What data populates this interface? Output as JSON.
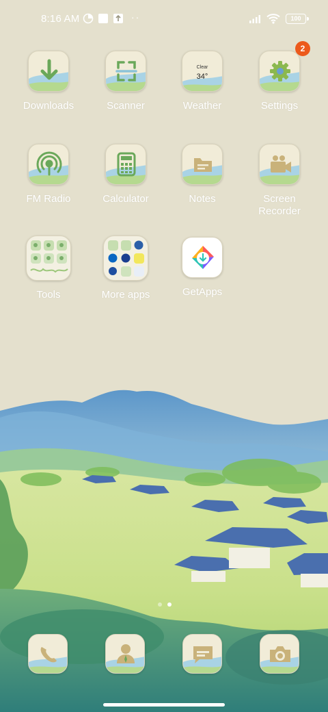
{
  "status_bar": {
    "time": "8:16 AM",
    "battery": "100",
    "dots": "··"
  },
  "apps": [
    {
      "label": "Downloads",
      "icon": "download-icon"
    },
    {
      "label": "Scanner",
      "icon": "scanner-icon"
    },
    {
      "label": "Weather",
      "icon": "weather-icon",
      "condition": "Clear",
      "temperature": "34°"
    },
    {
      "label": "Settings",
      "icon": "gear-icon",
      "badge": "2"
    },
    {
      "label": "FM Radio",
      "icon": "radio-icon"
    },
    {
      "label": "Calculator",
      "icon": "calculator-icon"
    },
    {
      "label": "Notes",
      "icon": "notes-icon"
    },
    {
      "label": "Screen Recorder",
      "icon": "video-camera-icon"
    },
    {
      "label": "Tools",
      "icon": "folder-icon"
    },
    {
      "label": "More apps",
      "icon": "folder-icon"
    },
    {
      "label": "GetApps",
      "icon": "getapps-icon"
    }
  ],
  "dock": [
    {
      "name": "phone",
      "icon": "phone-icon"
    },
    {
      "name": "contacts",
      "icon": "contacts-icon"
    },
    {
      "name": "messages",
      "icon": "messages-icon"
    },
    {
      "name": "camera",
      "icon": "camera-icon"
    }
  ],
  "pages": {
    "count": 2,
    "current": 2
  },
  "colors": {
    "badge": "#ec5a1c",
    "wallpaper_sky": "#e4e0cd",
    "icon_green": "#7aae6a",
    "icon_blue": "#6b9fd0"
  }
}
